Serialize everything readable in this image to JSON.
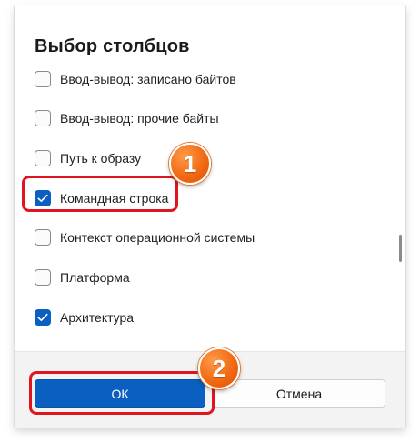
{
  "dialog": {
    "title": "Выбор столбцов"
  },
  "columns": [
    {
      "label": "Ввод-вывод: записано байтов",
      "checked": false
    },
    {
      "label": "Ввод-вывод: прочие байты",
      "checked": false
    },
    {
      "label": "Путь к образу",
      "checked": false
    },
    {
      "label": "Командная строка",
      "checked": true
    },
    {
      "label": "Контекст операционной системы",
      "checked": false
    },
    {
      "label": "Платформа",
      "checked": false
    },
    {
      "label": "Архитектура",
      "checked": true
    }
  ],
  "footer": {
    "ok_label": "ОК",
    "cancel_label": "Отмена"
  },
  "annotations": {
    "badge_1": "1",
    "badge_2": "2"
  },
  "colors": {
    "accent": "#0a5fc1",
    "highlight": "#e0151f",
    "badge": "#f26a12"
  }
}
